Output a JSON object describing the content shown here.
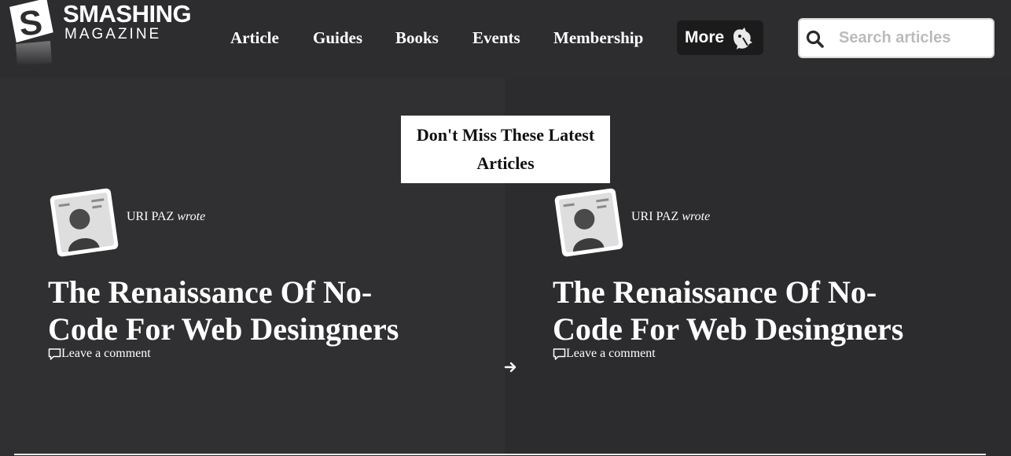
{
  "header": {
    "logo_word": "SMASHING",
    "logo_sub": "MAGAZINE",
    "nav": [
      {
        "label": "Article"
      },
      {
        "label": "Guides"
      },
      {
        "label": "Books"
      },
      {
        "label": "Events"
      },
      {
        "label": "Membership"
      }
    ],
    "more_label": "More",
    "more_icon": "cat-icon",
    "search": {
      "placeholder": "Search articles",
      "value": "",
      "icon": "search-icon"
    }
  },
  "main": {
    "section_title": "Don't Miss These Latest Articles",
    "articles": [
      {
        "author": "URI PAZ",
        "verb": "wrote",
        "title": "The Renaissance Of No-Code For Web Desingners",
        "comments_label": "Leave a comment"
      },
      {
        "author": "URI PAZ",
        "verb": "wrote",
        "title": "The Renaissance Of No-Code For Web Desingners",
        "comments_label": "Leave a comment"
      }
    ]
  },
  "colors": {
    "background": "#2f2f31",
    "text": "#ffffff",
    "label_bg": "#ffffff",
    "more_bg": "#1b1b1c"
  }
}
